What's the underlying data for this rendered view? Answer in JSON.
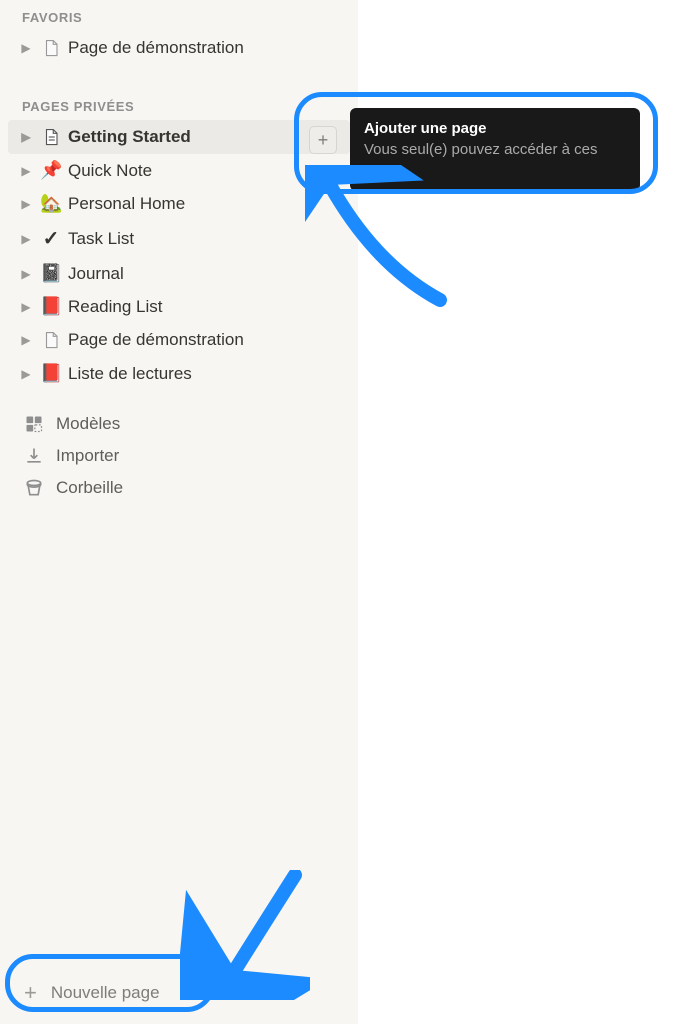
{
  "sidebar": {
    "favoris_label": "FAVORIS",
    "favoris_items": [
      {
        "label": "Page de démonstration",
        "icon": "page-light"
      }
    ],
    "private_label": "PAGES PRIVÉES",
    "private_items": [
      {
        "label": "Getting Started",
        "icon": "page",
        "selected": true
      },
      {
        "label": "Quick Note",
        "icon": "📌"
      },
      {
        "label": "Personal Home",
        "icon": "🏡"
      },
      {
        "label": "Task List",
        "icon": "check"
      },
      {
        "label": "Journal",
        "icon": "📓"
      },
      {
        "label": "Reading List",
        "icon": "📕"
      },
      {
        "label": "Page de démonstration",
        "icon": "page-light"
      },
      {
        "label": "Liste de lectures",
        "icon": "📕"
      }
    ],
    "utilities": [
      {
        "label": "Modèles",
        "icon": "templates"
      },
      {
        "label": "Importer",
        "icon": "import"
      },
      {
        "label": "Corbeille",
        "icon": "trash"
      }
    ],
    "new_page_label": "Nouvelle page"
  },
  "tooltip": {
    "title": "Ajouter une page",
    "body": "Vous seul(e) pouvez accéder à ces pages."
  },
  "colors": {
    "highlight": "#1b8bff"
  }
}
